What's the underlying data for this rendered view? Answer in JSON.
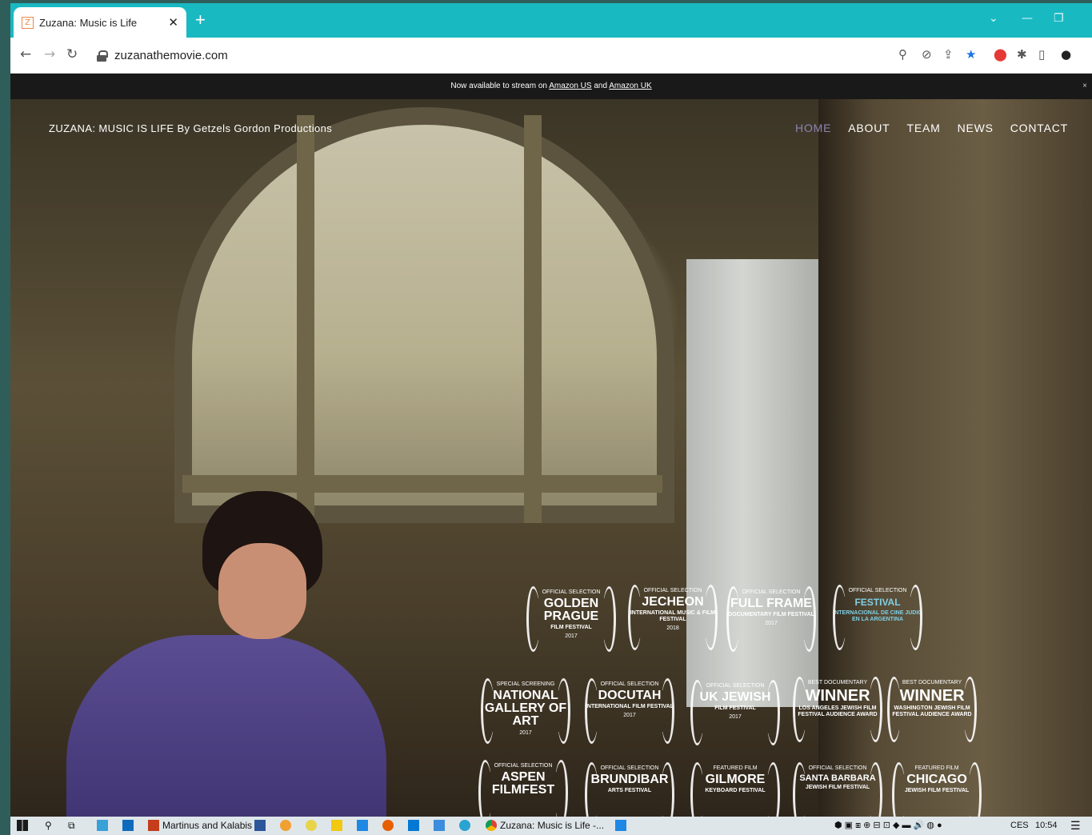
{
  "browser": {
    "tab_title": "Zuzana: Music is Life",
    "tab_favicon": "Z",
    "url": "zuzanathemovie.com"
  },
  "page": {
    "announcement_prefix": "Now available to stream on ",
    "announcement_link1": "Amazon US",
    "announcement_mid": " and ",
    "announcement_link2": "Amazon UK",
    "announcement_close": "×",
    "brand": "ZUZANA: MUSIC IS LIFE By Getzels Gordon Productions",
    "nav": [
      "HOME",
      "ABOUT",
      "TEAM",
      "NEWS",
      "CONTACT"
    ],
    "nav_active": "HOME"
  },
  "awards": [
    {
      "top": "OFFICIAL SELECTION",
      "main": "GOLDEN PRAGUE",
      "sub": "FILM FESTIVAL",
      "year": "2017"
    },
    {
      "top": "OFFICIAL SELECTION",
      "main": "JECHEON",
      "sub": "INTERNATIONAL MUSIC & FILM FESTIVAL",
      "year": "2018"
    },
    {
      "top": "OFFICIAL SELECTION",
      "main": "FULL FRAME",
      "sub": "DOCUMENTARY FILM FESTIVAL",
      "year": "2017"
    },
    {
      "top": "OFFICIAL SELECTION",
      "main": "FESTIVAL",
      "sub": "INTERNACIONAL DE CINE JUDIO EN LA ARGENTINA",
      "year": ""
    },
    {
      "top": "SPECIAL SCREENING",
      "main": "NATIONAL GALLERY OF ART",
      "sub": "",
      "year": "2017"
    },
    {
      "top": "OFFICIAL SELECTION",
      "main": "DOCUTAH",
      "sub": "INTERNATIONAL FILM FESTIVAL",
      "year": "2017"
    },
    {
      "top": "OFFICIAL SELECTION",
      "main": "UK JEWISH",
      "sub": "FILM FESTIVAL",
      "year": "2017"
    },
    {
      "top": "BEST DOCUMENTARY",
      "main": "WINNER",
      "sub": "LOS ANGELES JEWISH FILM FESTIVAL AUDIENCE AWARD",
      "year": ""
    },
    {
      "top": "BEST DOCUMENTARY",
      "main": "WINNER",
      "sub": "WASHINGTON JEWISH FILM FESTIVAL AUDIENCE AWARD",
      "year": ""
    },
    {
      "top": "OFFICIAL SELECTION",
      "main": "ASPEN FILMFEST",
      "sub": "",
      "year": ""
    },
    {
      "top": "OFFICIAL SELECTION",
      "main": "BRUNDIBAR",
      "sub": "ARTS FESTIVAL",
      "year": ""
    },
    {
      "top": "FEATURED FILM",
      "main": "GILMORE",
      "sub": "KEYBOARD FESTIVAL",
      "year": ""
    },
    {
      "top": "OFFICIAL SELECTION",
      "main": "SANTA BARBARA",
      "sub": "JEWISH FILM FESTIVAL",
      "year": ""
    },
    {
      "top": "FEATURED FILM",
      "main": "CHICAGO",
      "sub": "JEWISH FILM FESTIVAL",
      "year": ""
    }
  ],
  "taskbar": {
    "item_ppt": "Martinus and Kalabis ...",
    "item_chrome": "Zuzana: Music is Life -...",
    "lang": "CES",
    "time": "10:54"
  }
}
